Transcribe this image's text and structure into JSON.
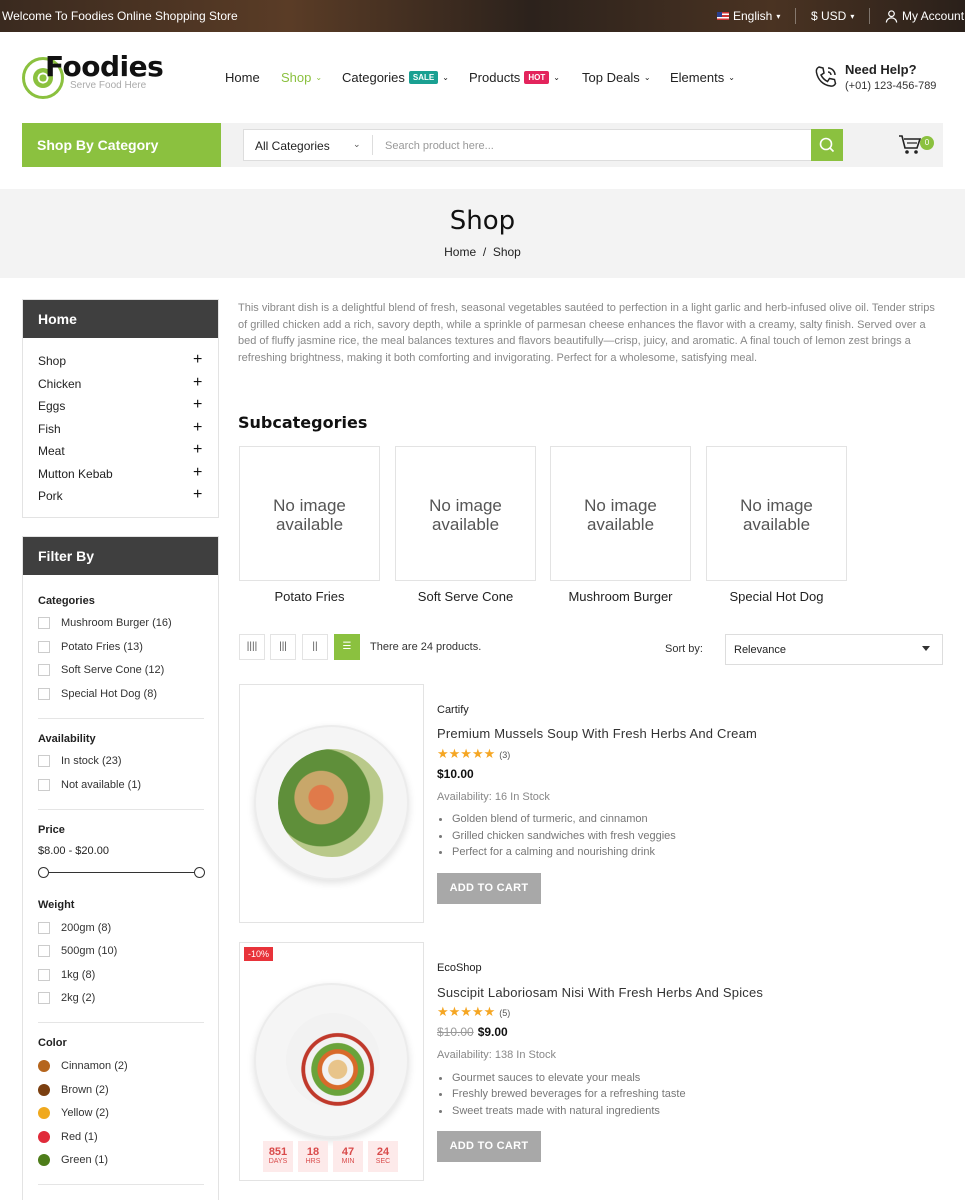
{
  "topbar": {
    "welcome": "Welcome To Foodies Online Shopping Store",
    "language": "English",
    "currency": "$ USD",
    "account": "My Account"
  },
  "header": {
    "logo_text": "Foodies",
    "logo_tagline": "Serve Food Here",
    "nav": [
      {
        "label": "Home"
      },
      {
        "label": "Shop"
      },
      {
        "label": "Categories",
        "badge": "SALE"
      },
      {
        "label": "Products",
        "badge": "HOT"
      },
      {
        "label": "Top Deals"
      },
      {
        "label": "Elements"
      }
    ],
    "help_title": "Need Help?",
    "help_phone": "(+01) 123-456-789"
  },
  "category_bar": {
    "shop_by": "Shop By Category",
    "select_value": "All Categories",
    "search_placeholder": "Search product here...",
    "cart_count": "0"
  },
  "hero": {
    "title": "Shop",
    "breadcrumb": [
      "Home",
      "/",
      "Shop"
    ]
  },
  "sidebar": {
    "home_title": "Home",
    "home_items": [
      "Shop",
      "Chicken",
      "Eggs",
      "Fish",
      "Meat",
      "Mutton Kebab",
      "Pork"
    ],
    "filter_title": "Filter By",
    "categories_title": "Categories",
    "categories": [
      "Mushroom Burger (16)",
      "Potato Fries (13)",
      "Soft Serve Cone (12)",
      "Special Hot Dog (8)"
    ],
    "availability_title": "Availability",
    "availability": [
      "In stock (23)",
      "Not available (1)"
    ],
    "price_title": "Price",
    "price_range": "$8.00 - $20.00",
    "weight_title": "Weight",
    "weights": [
      "200gm (8)",
      "500gm (10)",
      "1kg (8)",
      "2kg (2)"
    ],
    "color_title": "Color",
    "colors": [
      {
        "label": "Cinnamon (2)",
        "hex": "#b5651d"
      },
      {
        "label": "Brown (2)",
        "hex": "#7b3f10"
      },
      {
        "label": "Yellow (2)",
        "hex": "#f0a91e"
      },
      {
        "label": "Red (1)",
        "hex": "#e02b3a"
      },
      {
        "label": "Green (1)",
        "hex": "#4e7d1a"
      }
    ]
  },
  "main": {
    "description": "This vibrant dish is a delightful blend of fresh, seasonal vegetables sautéed to perfection in a light garlic and herb-infused olive oil. Tender strips of grilled chicken add a rich, savory depth, while a sprinkle of parmesan cheese enhances the flavor with a creamy, salty finish. Served over a bed of fluffy jasmine rice, the meal balances textures and flavors beautifully—crisp, juicy, and aromatic. A final touch of lemon zest brings a refreshing brightness, making it both comforting and invigorating. Perfect for a wholesome, satisfying meal.",
    "subcategories_title": "Subcategories",
    "no_image": "No image available",
    "subcategories": [
      "Potato Fries",
      "Soft Serve Cone",
      "Mushroom Burger",
      "Special Hot Dog"
    ],
    "product_count": "There are 24 products.",
    "sort_label": "Sort by:",
    "sort_value": "Relevance",
    "products": [
      {
        "brand": "Cartify",
        "title": "Premium Mussels Soup With Fresh Herbs And Cream",
        "stars": "★★★★★",
        "reviews": "(3)",
        "price": "$10.00",
        "availability": "Availability: 16 In Stock",
        "bullets": [
          "Golden blend of turmeric, and cinnamon",
          "Grilled chicken sandwiches with fresh veggies",
          "Perfect for a calming and nourishing drink"
        ],
        "button": "ADD TO CART"
      },
      {
        "brand": "EcoShop",
        "title": "Suscipit Laboriosam Nisi With Fresh Herbs And Spices",
        "stars": "★★★★★",
        "reviews": "(5)",
        "discount": "-10%",
        "old_price": "$10.00",
        "price": "$9.00",
        "availability": "Availability: 138 In Stock",
        "bullets": [
          "Gourmet sauces to elevate your meals",
          "Freshly brewed beverages for a refreshing taste",
          "Sweet treats made with natural ingredients"
        ],
        "button": "ADD TO CART",
        "countdown": [
          {
            "value": "851",
            "unit": "DAYS"
          },
          {
            "value": "18",
            "unit": "HRS"
          },
          {
            "value": "47",
            "unit": "MIN"
          },
          {
            "value": "24",
            "unit": "SEC"
          }
        ]
      }
    ]
  }
}
